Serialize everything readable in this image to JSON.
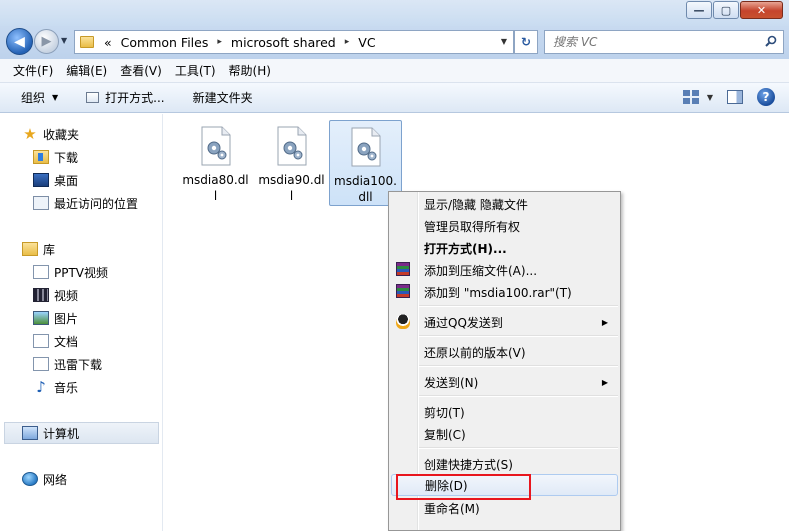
{
  "address": {
    "overflow_glyph": "«",
    "crumbs": [
      "Common Files",
      "microsoft shared",
      "VC"
    ],
    "separator": "▸",
    "refresh_glyph": "↻"
  },
  "search": {
    "placeholder": "搜索 VC"
  },
  "window": {
    "minimize": "—",
    "maximize": "▢",
    "close": "✕"
  },
  "nav_buttons": {
    "back": "◀",
    "forward": "▶",
    "recent": "▼"
  },
  "menubar": [
    "文件(F)",
    "编辑(E)",
    "查看(V)",
    "工具(T)",
    "帮助(H)"
  ],
  "toolbar": {
    "organize": "组织",
    "open_with": "打开方式...",
    "new_folder": "新建文件夹",
    "caret": "▼",
    "help": "?"
  },
  "navpane": {
    "favorites": {
      "label": "收藏夹",
      "items": [
        "下载",
        "桌面",
        "最近访问的位置"
      ]
    },
    "libraries": {
      "label": "库",
      "items": [
        "PPTV视频",
        "视频",
        "图片",
        "文档",
        "迅雷下载",
        "音乐"
      ]
    },
    "computer": "计算机",
    "network": "网络"
  },
  "files": [
    {
      "name": "msdia80.dll",
      "selected": false
    },
    {
      "name": "msdia90.dll",
      "selected": false
    },
    {
      "name": "msdia100.dll",
      "selected": true
    }
  ],
  "context_menu": {
    "items": [
      {
        "label": "显示/隐藏 隐藏文件"
      },
      {
        "label": "管理员取得所有权"
      },
      {
        "label": "打开方式(H)..."
      },
      {
        "label": "添加到压缩文件(A)..."
      },
      {
        "label": "添加到 \"msdia100.rar\"(T)"
      },
      {
        "label": "通过QQ发送到"
      },
      {
        "label": "还原以前的版本(V)"
      },
      {
        "label": "发送到(N)"
      },
      {
        "label": "剪切(T)"
      },
      {
        "label": "复制(C)"
      },
      {
        "label": "创建快捷方式(S)"
      },
      {
        "label": "删除(D)"
      },
      {
        "label": "重命名(M)"
      }
    ],
    "submenu_arrow": "▶"
  },
  "colors": {
    "highlight_box": "#e8161e",
    "selection": "#cde2f8",
    "menu_bg": "#f0f0f0"
  }
}
